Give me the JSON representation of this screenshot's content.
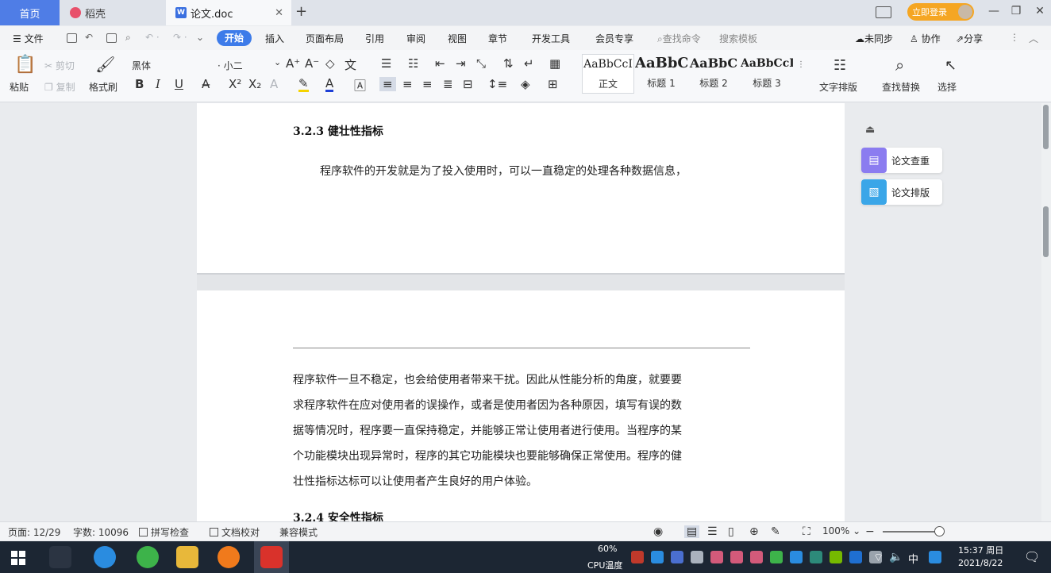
{
  "tabs": {
    "home": "首页",
    "daoke": "稻壳",
    "doc": "论文.doc",
    "add": "+",
    "login": "立即登录"
  },
  "menu": {
    "file": "文件",
    "items": [
      "开始",
      "插入",
      "页面布局",
      "引用",
      "审阅",
      "视图",
      "章节",
      "开发工具",
      "会员专享"
    ],
    "search_cmd": "查找命令",
    "search_tpl": "搜索模板",
    "sync": "未同步",
    "collab": "协作",
    "share": "分享"
  },
  "ribbon": {
    "paste": "粘贴",
    "cut": "剪切",
    "copy": "复制",
    "format_painter": "格式刷",
    "font": "黑体",
    "size": "小二",
    "styles": [
      {
        "sample": "AaBbCcI",
        "name": "正文"
      },
      {
        "sample": "AaBbC",
        "name": "标题 1"
      },
      {
        "sample": "AaBbC",
        "name": "标题 2"
      },
      {
        "sample": "AaBbCcI",
        "name": "标题 3"
      }
    ],
    "text_layout": "文字排版",
    "find_replace": "查找替换",
    "select": "选择"
  },
  "document": {
    "page1_heading": "3.2.3  健壮性指标",
    "page1_para": "程序软件的开发就是为了投入使用时，可以一直稳定的处理各种数据信息，",
    "page2_header": "",
    "page2_lines": [
      "程序软件一旦不稳定，也会给使用者带来干扰。因此从性能分析的角度，就要要",
      "求程序软件在应对使用者的误操作，或者是使用者因为各种原因，填写有误的数",
      "据等情况时，程序要一直保持稳定，并能够正常让使用者进行使用。当程序的某",
      "个功能模块出现异常时，程序的其它功能模块也要能够确保正常使用。程序的健",
      "壮性指标达标可以让使用者产生良好的用户体验。"
    ],
    "page2_heading": "3.2.4  安全性指标"
  },
  "sidepanel": {
    "check": "论文查重",
    "format": "论文排版"
  },
  "status": {
    "page": "页面: 12/29",
    "words": "字数: 10096",
    "spell": "拼写检查",
    "proof": "文档校对",
    "compat": "兼容模式",
    "zoom": "100%"
  },
  "taskbar": {
    "cpu": "60%",
    "cpu_label": "CPU温度",
    "ime": "中",
    "time": "15:37 周日",
    "date": "2021/8/22"
  }
}
